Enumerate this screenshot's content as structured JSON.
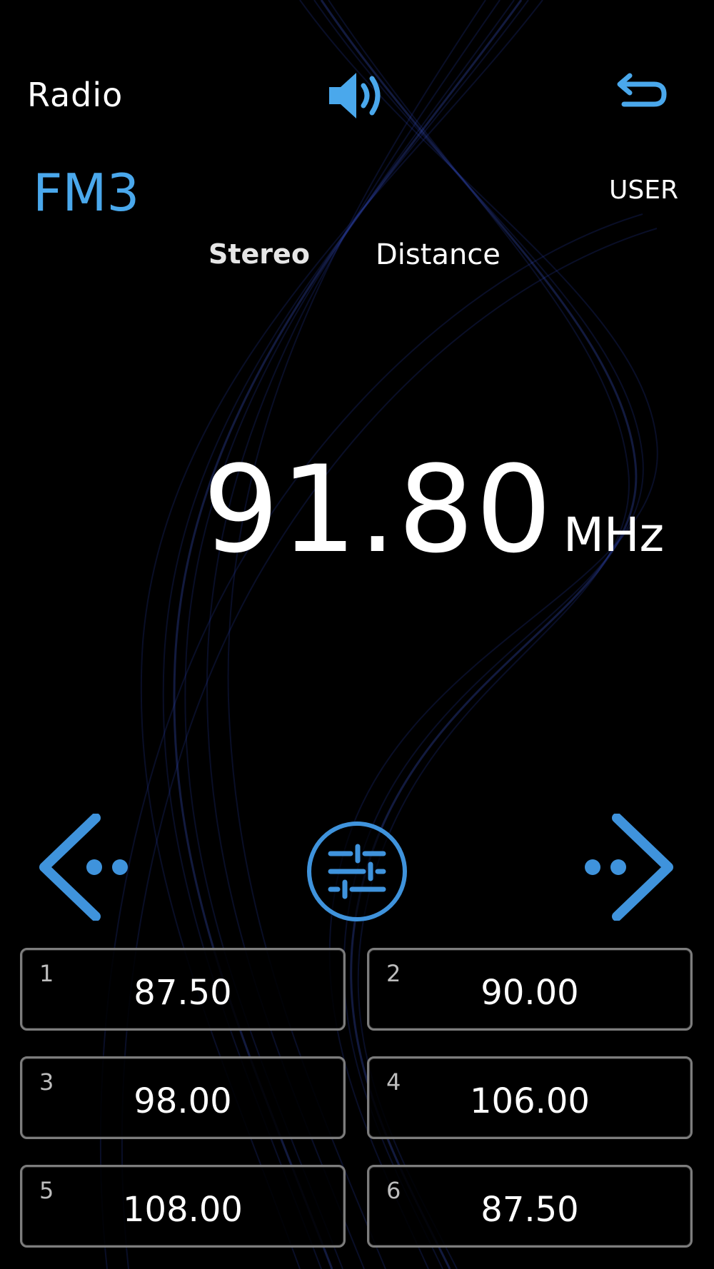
{
  "header": {
    "title": "Radio",
    "volume_icon": "volume-icon",
    "back_icon": "back-icon"
  },
  "status": {
    "band": "FM3",
    "mode": "USER",
    "stereo": "Stereo",
    "distance": "Distance"
  },
  "tuner": {
    "frequency": "91.80",
    "unit": "MHz"
  },
  "controls": {
    "prev_icon": "seek-prev-icon",
    "settings_icon": "equalizer-icon",
    "next_icon": "seek-next-icon"
  },
  "presets": [
    {
      "number": "1",
      "frequency": "87.50"
    },
    {
      "number": "2",
      "frequency": "90.00"
    },
    {
      "number": "3",
      "frequency": "98.00"
    },
    {
      "number": "4",
      "frequency": "106.00"
    },
    {
      "number": "5",
      "frequency": "108.00"
    },
    {
      "number": "6",
      "frequency": "87.50"
    }
  ],
  "colors": {
    "background": "#000000",
    "accent": "#4aa8ec",
    "text": "#ffffff",
    "wave": "#2a3fb0"
  }
}
